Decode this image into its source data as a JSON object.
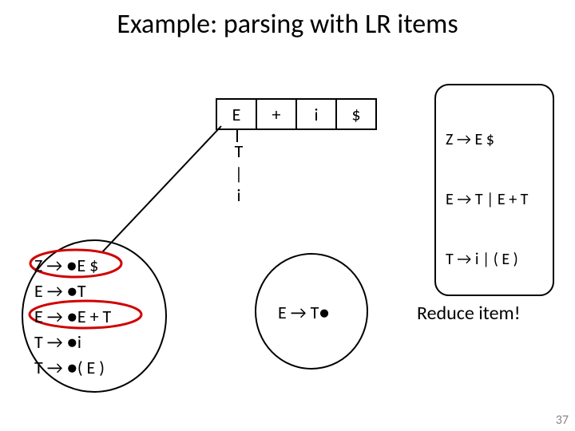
{
  "title": "Example: parsing with LR items",
  "input_cells": [
    "E",
    "+",
    "i",
    "$"
  ],
  "grammar": {
    "line1": "Z → E $",
    "line2": "E → T | E + T",
    "line3": "T → i | ( E )"
  },
  "stack": {
    "top": "T",
    "mid": "|",
    "bot": "i"
  },
  "items_left": {
    "l1": "Z → ●E $",
    "l2": "E → ●T",
    "l3": "E → ●E + T",
    "l4": "T → ●i",
    "l5": "T → ●( E )"
  },
  "reduce_item": "E → T●",
  "reduce_label": "Reduce item!",
  "page_number": "37"
}
